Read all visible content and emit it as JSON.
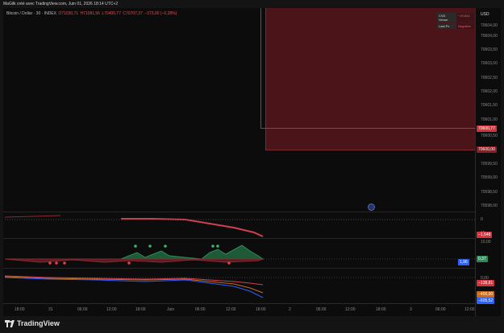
{
  "header": {
    "caption": "MaGilk créé avec TradingView.com, Juin 01, 2026 18:14 UTC+2"
  },
  "legend": {
    "symbol": "Bitcoin / Dollar · 30 · INDEX",
    "o": "O71030,71",
    "h": "H71081,56",
    "l": "L70400,77",
    "c": "C70707,37",
    "chg": "−373,00 (−0,28%)"
  },
  "axis": {
    "currency": "USD",
    "ticks": [
      "70604,00",
      "70604,00",
      "70603,50",
      "70603,00",
      "70602,50",
      "70602,00",
      "70601,50",
      "70601,00",
      "70600,50",
      "70599,50",
      "70599,00",
      "70598,50",
      "70598,00"
    ],
    "price_tag": "70600,77",
    "zone_tag": "70600,00",
    "ind1_zero": "0",
    "ind1_tag": "−1,548",
    "ind2_top": "15",
    "ind2_mid": "10,00",
    "ind2_tag_blue": "1,96",
    "ind2_tag_green": "0,37",
    "ind3_zero": "0,00",
    "ind3_tag1": "−138,81",
    "ind3_tag2": "−400,00",
    "ind3_tag3": "−605,52"
  },
  "info_box": {
    "rows": [
      {
        "k": "CVD Venue",
        "v": "−29,844"
      },
      {
        "k": "Last Px",
        "v": "Negative"
      }
    ]
  },
  "xaxis": {
    "labels": [
      "18:00",
      "31",
      "06:00",
      "12:00",
      "18:00",
      "Juin",
      "06:00",
      "12:00",
      "18:00",
      "2",
      "06:00",
      "12:00",
      "18:00",
      "3",
      "06:00",
      "12:00"
    ]
  },
  "footer": {
    "brand": "TradingView"
  },
  "colors": {
    "up": "#2e8b57",
    "down": "#e04050",
    "zone": "#4a1418",
    "blue": "#2962ff"
  }
}
